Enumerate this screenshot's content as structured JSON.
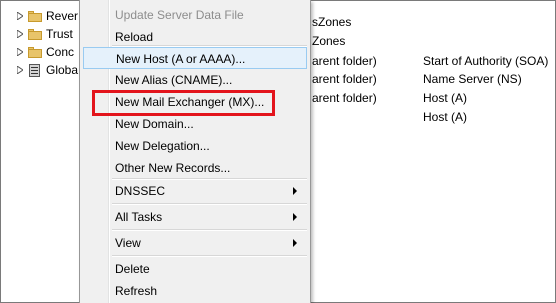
{
  "tree": {
    "items": [
      {
        "label": "Rever",
        "icon": "folder-icon"
      },
      {
        "label": "Trust",
        "icon": "folder-icon"
      },
      {
        "label": "Conc",
        "icon": "folder-icon"
      },
      {
        "label": "Globa",
        "icon": "server-icon"
      }
    ]
  },
  "content": {
    "header_fragments": [
      "sZones",
      "Zones"
    ],
    "rows": [
      {
        "name": "arent folder)",
        "type": "Start of Authority (SOA)"
      },
      {
        "name": "arent folder)",
        "type": "Name Server (NS)"
      },
      {
        "name": "arent folder)",
        "type": "Host (A)"
      },
      {
        "name": "",
        "type": "Host (A)"
      }
    ]
  },
  "menu": {
    "items": [
      {
        "label": "Update Server Data File",
        "disabled": true
      },
      {
        "label": "Reload"
      },
      {
        "label": "New Host (A or AAAA)...",
        "hover": true
      },
      {
        "label": "New Alias (CNAME)..."
      },
      {
        "label": "New Mail Exchanger (MX)...",
        "highlighted": true
      },
      {
        "label": "New Domain..."
      },
      {
        "label": "New Delegation..."
      },
      {
        "label": "Other New Records..."
      },
      {
        "label": "DNSSEC",
        "submenu": true
      },
      {
        "label": "All Tasks",
        "submenu": true
      },
      {
        "label": "View",
        "submenu": true
      },
      {
        "label": "Delete"
      },
      {
        "label": "Refresh"
      }
    ]
  },
  "colors": {
    "highlight_border": "#e3141c",
    "hover_bg": "#e5f1fb",
    "hover_border": "#99cbf1",
    "disabled_text": "#8d8d8d"
  }
}
